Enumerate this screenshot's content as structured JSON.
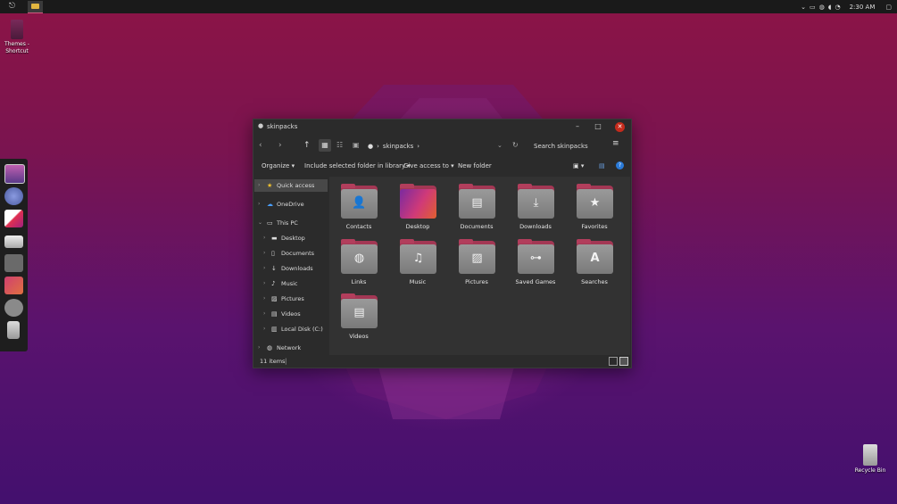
{
  "taskbar": {
    "clock": "2:30 AM",
    "tray_icons": [
      "chevron-up-icon",
      "battery-icon",
      "globe-icon",
      "volume-icon",
      "wifi-icon"
    ]
  },
  "desktop": {
    "themes_shortcut_label": "Themes - Shortcut",
    "recycle_bin_label": "Recycle Bin"
  },
  "window": {
    "title": "skinpacks",
    "breadcrumb": [
      "skinpacks"
    ],
    "search_placeholder": "Search skinpacks",
    "commands": {
      "organize": "Organize",
      "include": "Include selected folder in library",
      "give_access": "Give access to",
      "new_folder": "New folder"
    },
    "sidebar": {
      "quick_access": "Quick access",
      "onedrive": "OneDrive",
      "this_pc": "This PC",
      "desktop": "Desktop",
      "documents": "Documents",
      "downloads": "Downloads",
      "music": "Music",
      "pictures": "Pictures",
      "videos": "Videos",
      "local_disk": "Local Disk (C:)",
      "network": "Network"
    },
    "items": [
      {
        "label": "Contacts",
        "icon": "person-icon"
      },
      {
        "label": "Desktop",
        "icon": "desktop-icon"
      },
      {
        "label": "Documents",
        "icon": "document-icon"
      },
      {
        "label": "Downloads",
        "icon": "download-icon"
      },
      {
        "label": "Favorites",
        "icon": "star-icon"
      },
      {
        "label": "Links",
        "icon": "globe-icon"
      },
      {
        "label": "Music",
        "icon": "music-icon"
      },
      {
        "label": "Pictures",
        "icon": "picture-icon"
      },
      {
        "label": "Saved Games",
        "icon": "gamepad-icon"
      },
      {
        "label": "Searches",
        "icon": "search-letter-icon"
      },
      {
        "label": "Videos",
        "icon": "film-icon"
      }
    ],
    "status": "11 items"
  }
}
